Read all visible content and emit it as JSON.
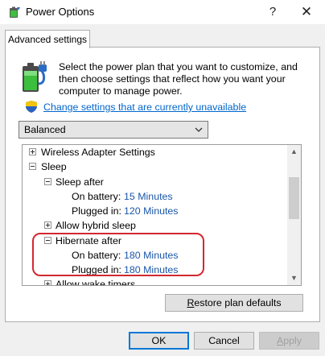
{
  "window": {
    "title": "Power Options",
    "help_glyph": "?",
    "close_glyph": "✕"
  },
  "tab": {
    "label": "Advanced settings"
  },
  "description": "Select the power plan that you want to customize, and then choose settings that reflect how you want your computer to manage power.",
  "change_link": "Change settings that are currently unavailable",
  "plan": {
    "selected": "Balanced"
  },
  "tree": {
    "wireless": "Wireless Adapter Settings",
    "sleep": "Sleep",
    "sleep_after": "Sleep after",
    "sleep_on_battery_label": "On battery:",
    "sleep_on_battery_value": "15 Minutes",
    "sleep_plugged_label": "Plugged in:",
    "sleep_plugged_value": "120 Minutes",
    "hybrid": "Allow hybrid sleep",
    "hibernate_after": "Hibernate after",
    "hib_on_battery_label": "On battery:",
    "hib_on_battery_value": "180 Minutes",
    "hib_plugged_label": "Plugged in:",
    "hib_plugged_value": "180 Minutes",
    "wake": "Allow wake timers"
  },
  "buttons": {
    "restore": {
      "underlined": "R",
      "rest": "estore plan defaults"
    },
    "ok": "OK",
    "cancel": "Cancel",
    "apply": {
      "underlined": "A",
      "rest": "pply"
    }
  },
  "colors": {
    "link": "#0066cc",
    "highlight": "#d3282f",
    "ok_border": "#0078d7"
  }
}
